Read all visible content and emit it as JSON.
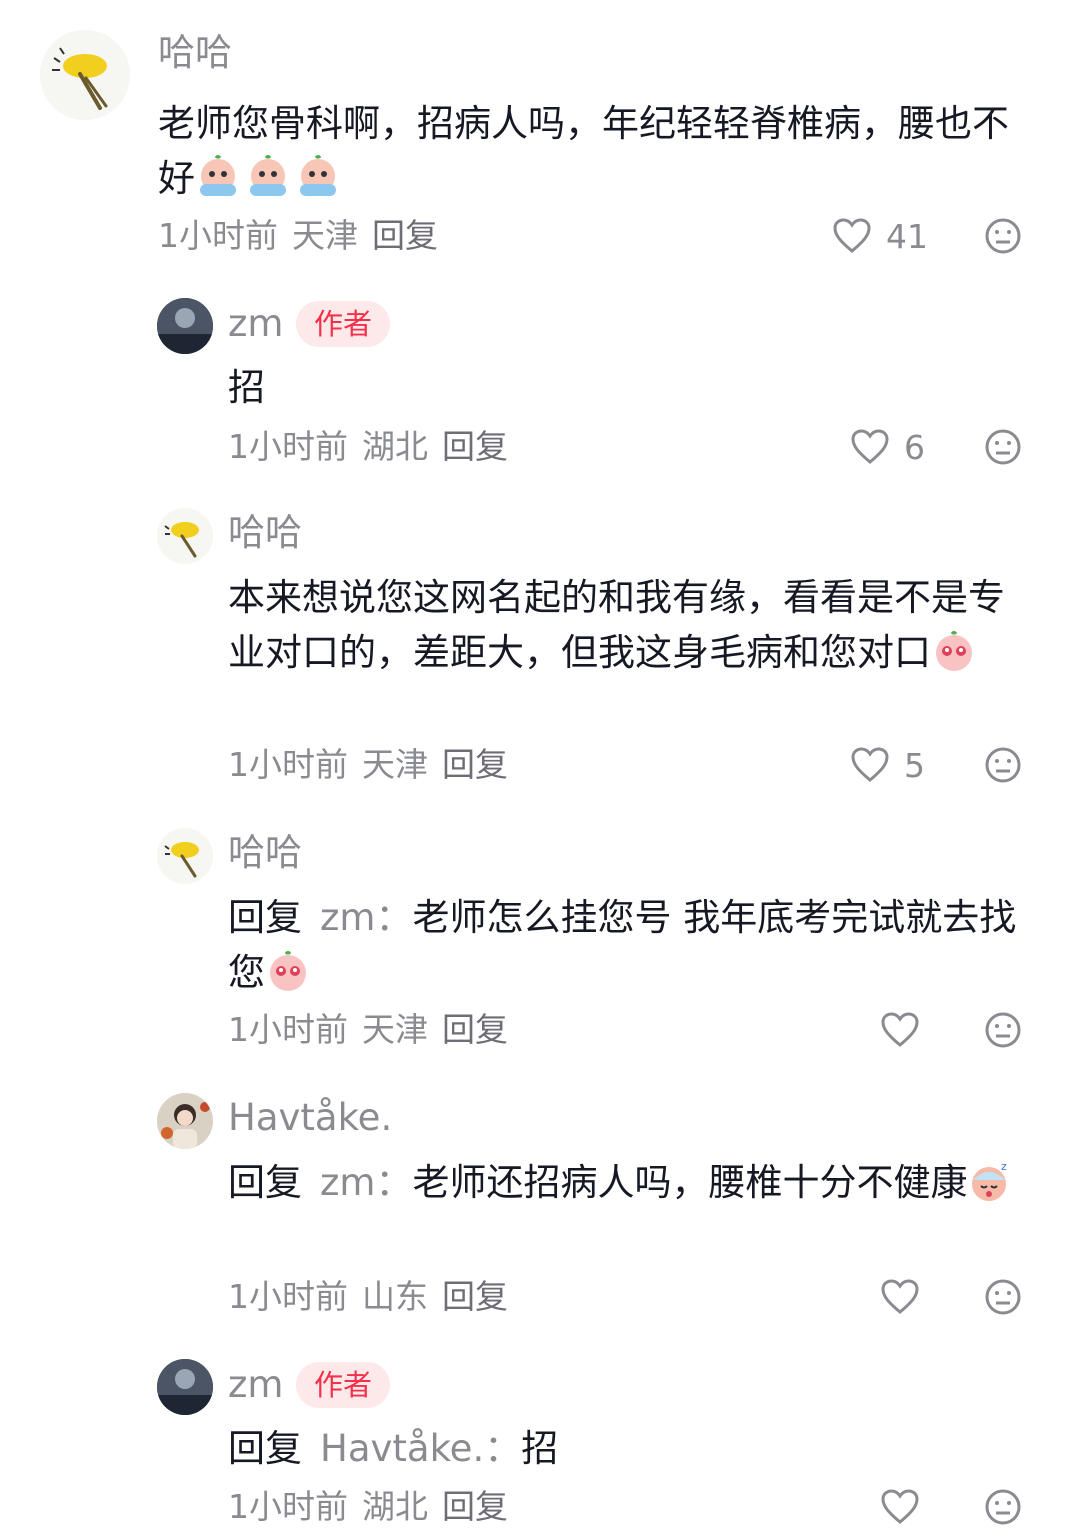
{
  "comments": [
    {
      "user": "哈哈",
      "text": "老师您骨科啊，招病人吗，年纪轻轻脊椎病，腰也不好",
      "emojis": [
        "crying-icon",
        "crying-icon",
        "crying-icon"
      ],
      "time": "1小时前",
      "location": "天津",
      "reply_label": "回复",
      "likes": "41"
    },
    {
      "user": "zm",
      "badge": "作者",
      "text": "招",
      "time": "1小时前",
      "location": "湖北",
      "reply_label": "回复",
      "likes": "6"
    },
    {
      "user": "哈哈",
      "text": "本来想说您这网名起的和我有缘，看看是不是专业对口的，差距大，但我这身毛病和您对口",
      "emojis": [
        "pleading-icon"
      ],
      "time": "1小时前",
      "location": "天津",
      "reply_label": "回复",
      "likes": "5"
    },
    {
      "user": "哈哈",
      "reply_prefix": "回复",
      "reply_to": "zm：",
      "text": "老师怎么挂您号 我年底考完试就去找您",
      "emojis": [
        "pleading-icon"
      ],
      "time": "1小时前",
      "location": "天津",
      "reply_label": "回复",
      "likes": ""
    },
    {
      "user": "Havtåke.",
      "reply_prefix": "回复",
      "reply_to": "zm：",
      "text": "老师还招病人吗，腰椎十分不健康",
      "emojis": [
        "sleepy-icon"
      ],
      "time": "1小时前",
      "location": "山东",
      "reply_label": "回复",
      "likes": ""
    },
    {
      "user": "zm",
      "badge": "作者",
      "reply_prefix": "回复",
      "reply_to": "Havtåke.：",
      "text": "招",
      "time": "1小时前",
      "location": "湖北",
      "reply_label": "回复",
      "likes": ""
    }
  ],
  "icons": {
    "like": "heart-outline-icon",
    "dislike": "neutral-face-icon"
  },
  "colors": {
    "author_badge_bg": "#fde8ea",
    "author_badge_text": "#f5304a",
    "secondary_text": "#8a8b91"
  }
}
